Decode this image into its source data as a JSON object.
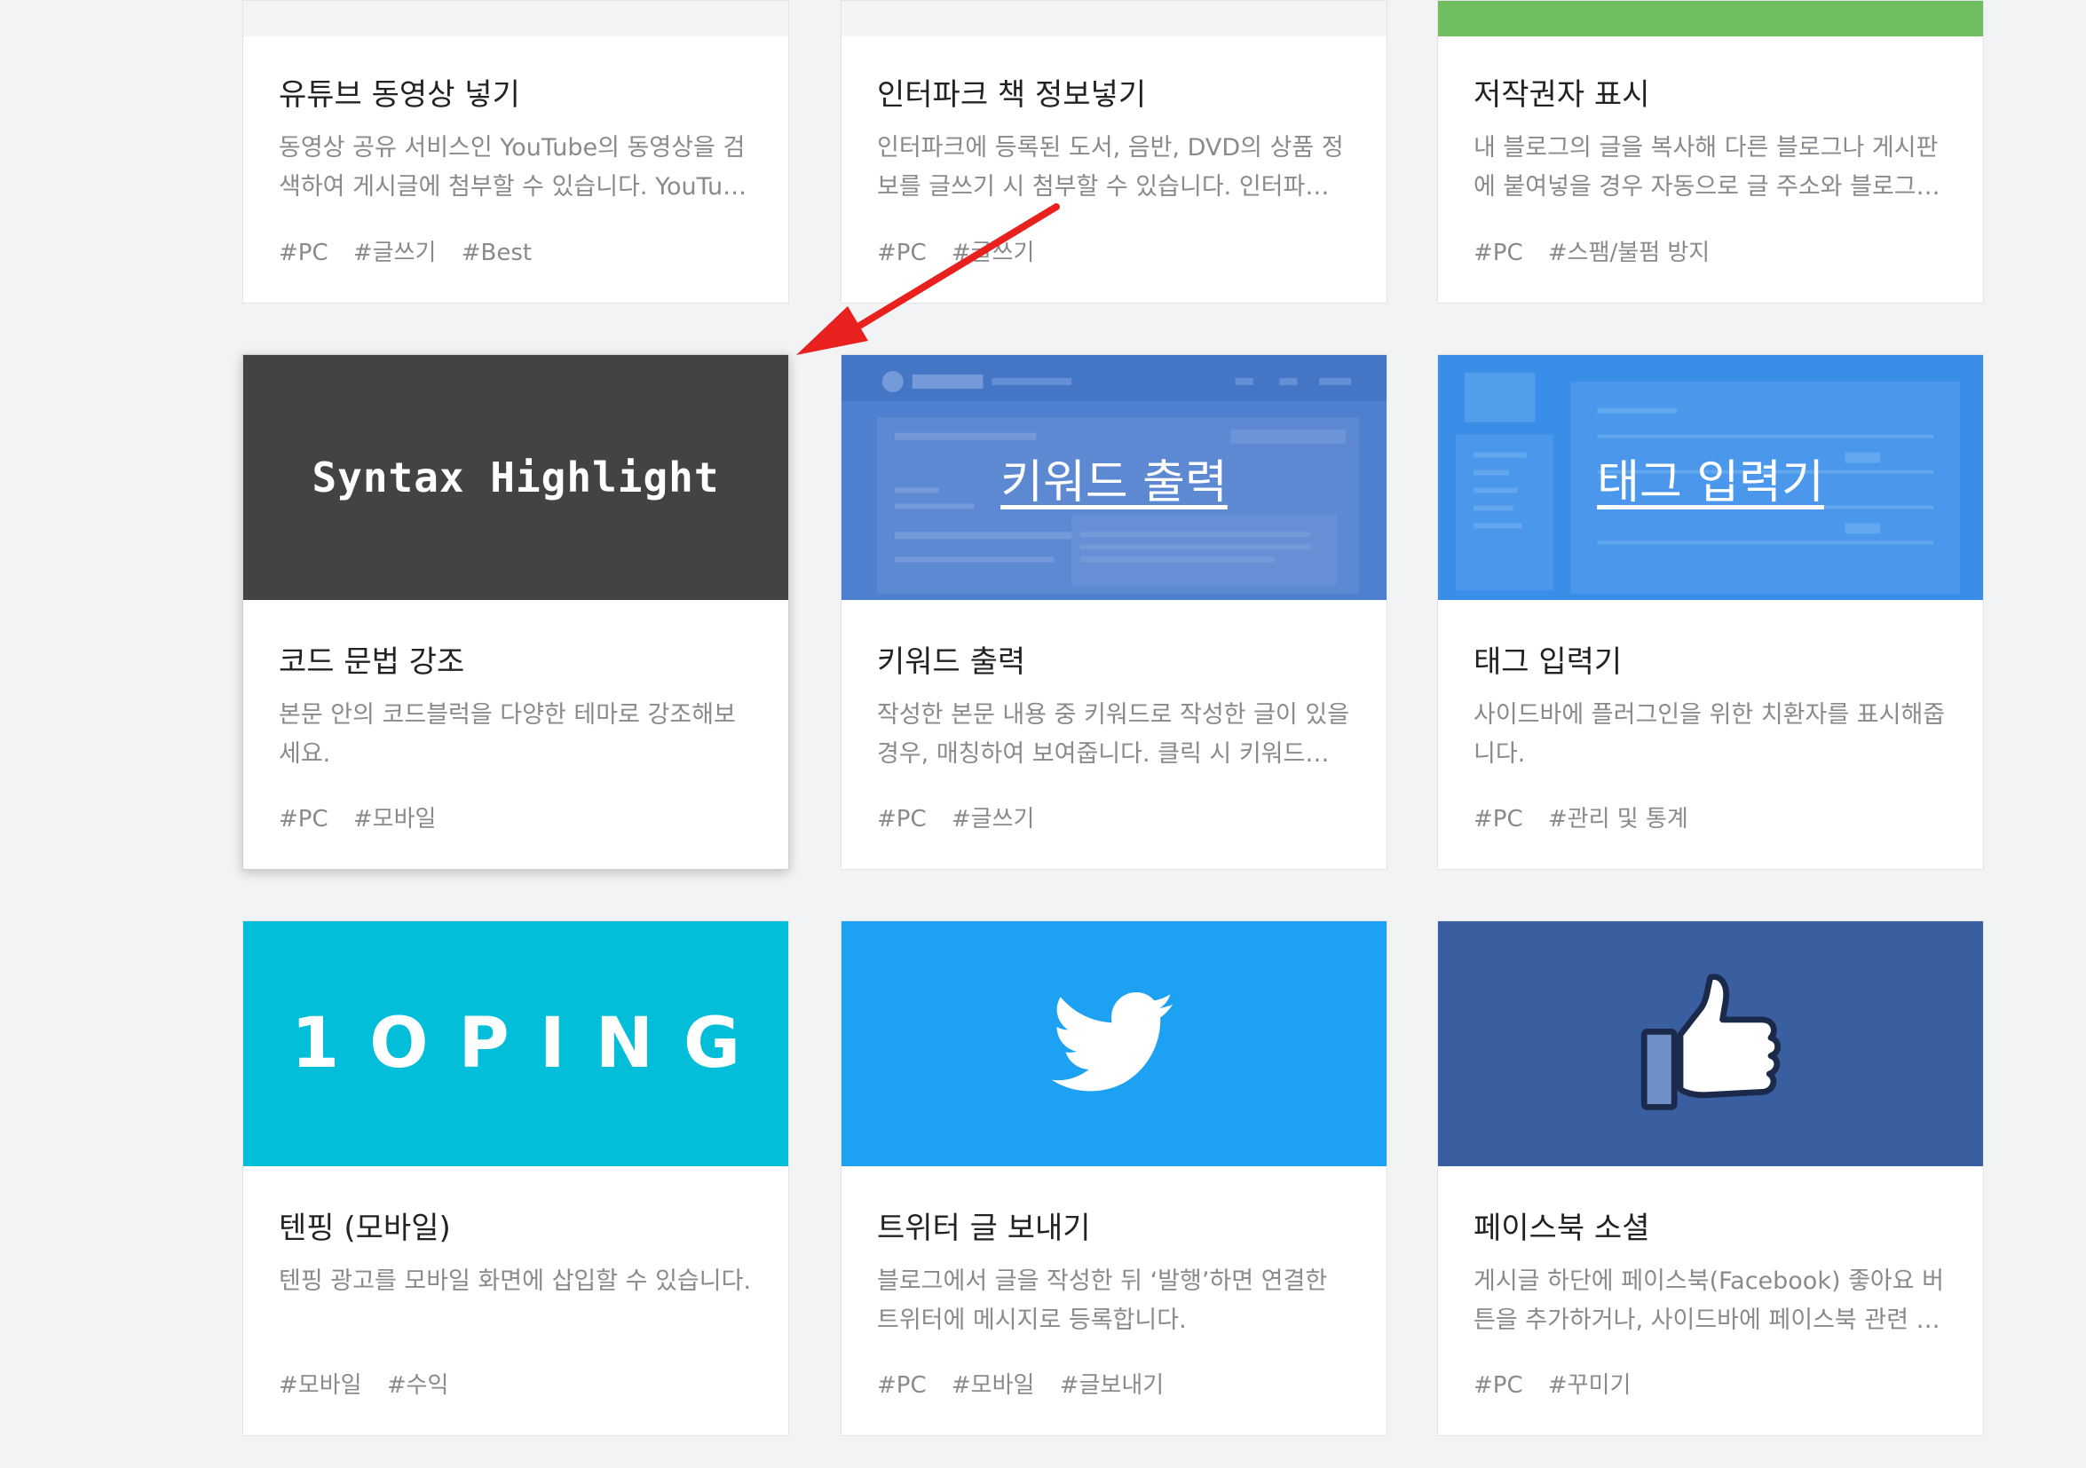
{
  "cards": [
    {
      "title": "유튜브 동영상 넣기",
      "desc": "동영상 공유 서비스인 YouTube의 동영상을 검색하여 게시글에 첨부할 수 있습니다. YouTu…",
      "tags": [
        "#PC",
        "#글쓰기",
        "#Best"
      ],
      "thumb_color": "#f4f4f5"
    },
    {
      "title": "인터파크 책 정보넣기",
      "desc": "인터파크에 등록된 도서, 음반, DVD의 상품 정보를 글쓰기 시 첨부할 수 있습니다. 인터파크…",
      "tags": [
        "#PC",
        "#글쓰기"
      ],
      "thumb_color": "#f4f4f5"
    },
    {
      "title": "저작권자 표시",
      "desc": "내 블로그의 글을 복사해 다른 블로그나 게시판에 붙여넣을 경우 자동으로 글 주소와 블로그…",
      "tags": [
        "#PC",
        "#스팸/불펌 방지"
      ],
      "thumb_color": "#6fbe5f"
    },
    {
      "title": "코드 문법 강조",
      "desc": "본문 안의 코드블럭을 다양한 테마로 강조해보세요.",
      "tags": [
        "#PC",
        "#모바일"
      ],
      "thumb_text": "Syntax Highlight",
      "thumb_color": "#434343"
    },
    {
      "title": "키워드 출력",
      "desc": "작성한 본문 내용 중 키워드로 작성한 글이 있을 경우, 매칭하여 보여줍니다. 클릭 시 키워드…",
      "tags": [
        "#PC",
        "#글쓰기"
      ],
      "thumb_text": "키워드 출력",
      "thumb_color": "#4f7fcf"
    },
    {
      "title": "태그 입력기",
      "desc": "사이드바에 플러그인을 위한 치환자를 표시해줍니다.",
      "tags": [
        "#PC",
        "#관리 및 통계"
      ],
      "thumb_text": "태그 입력기",
      "thumb_color": "#3a8ee8"
    },
    {
      "title": "텐핑 (모바일)",
      "desc": "텐핑 광고를 모바일 화면에 삽입할 수 있습니다.",
      "tags": [
        "#모바일",
        "#수익"
      ],
      "thumb_text": "1OPING",
      "thumb_color": "#02bed8"
    },
    {
      "title": "트위터 글 보내기",
      "desc": "블로그에서 글을 작성한 뒤 ‘발행’하면 연결한 트위터에 메시지로 등록합니다.",
      "tags": [
        "#PC",
        "#모바일",
        "#글보내기"
      ],
      "thumb_icon": "twitter-bird-icon",
      "thumb_color": "#1da1f2"
    },
    {
      "title": "페이스북 소셜",
      "desc": "게시글 하단에 페이스북(Facebook) 좋아요 버튼을 추가하거나, 사이드바에 페이스북 관련 …",
      "tags": [
        "#PC",
        "#꾸미기"
      ],
      "thumb_icon": "thumbs-up-icon",
      "thumb_color": "#3a5fa0"
    }
  ],
  "annotation": {
    "arrow_color": "#e8211f"
  }
}
